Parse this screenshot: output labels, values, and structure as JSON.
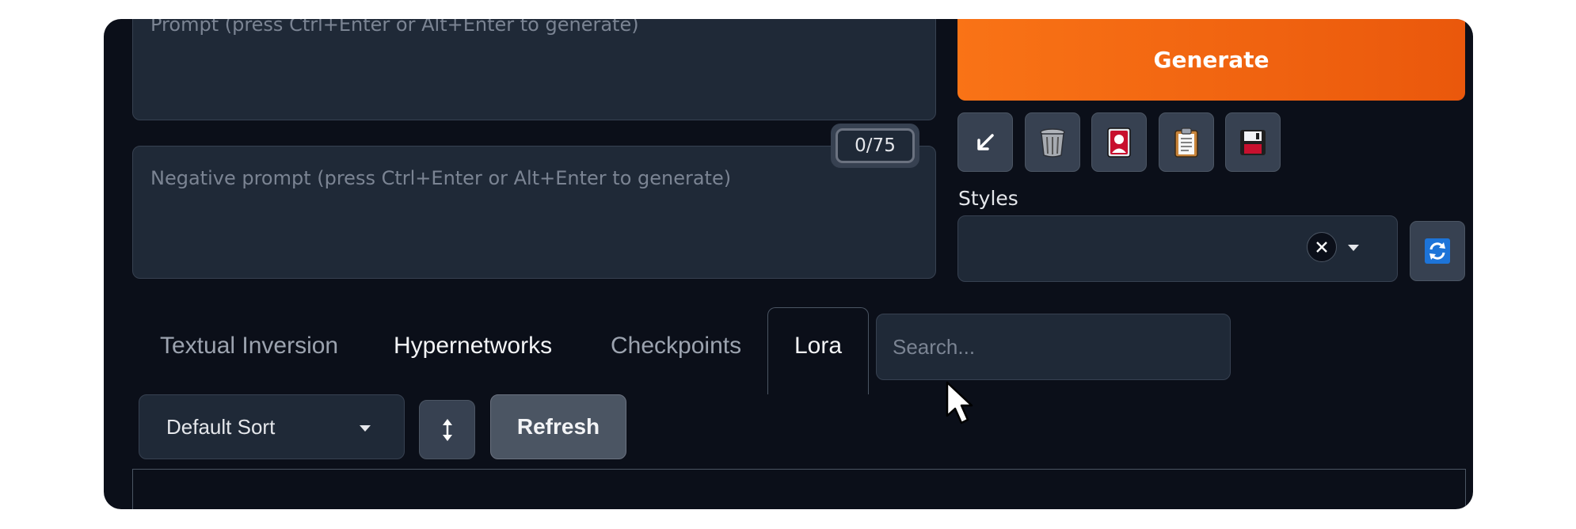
{
  "prompt": {
    "placeholder": "Prompt (press Ctrl+Enter or Alt+Enter to generate)"
  },
  "negative_prompt": {
    "placeholder": "Negative prompt (press Ctrl+Enter or Alt+Enter to generate)"
  },
  "token_counter": "0/75",
  "generate_button": "Generate",
  "tool_buttons": [
    {
      "name": "read-params-icon",
      "glyph": "↙"
    },
    {
      "name": "trash-icon",
      "glyph": "🗑"
    },
    {
      "name": "image-card-icon",
      "glyph": "🎴"
    },
    {
      "name": "clipboard-icon",
      "glyph": "📋"
    },
    {
      "name": "save-icon",
      "glyph": "💾"
    }
  ],
  "styles": {
    "label": "Styles",
    "value": ""
  },
  "extra_tabs": [
    "Textual Inversion",
    "Hypernetworks",
    "Checkpoints",
    "Lora"
  ],
  "active_tab": "Lora",
  "search": {
    "placeholder": "Search..."
  },
  "sort": {
    "selected": "Default Sort"
  },
  "refresh_label": "Refresh",
  "colors": {
    "accent": "#f97316",
    "background": "#0b0f19",
    "panel": "#1f2937"
  }
}
